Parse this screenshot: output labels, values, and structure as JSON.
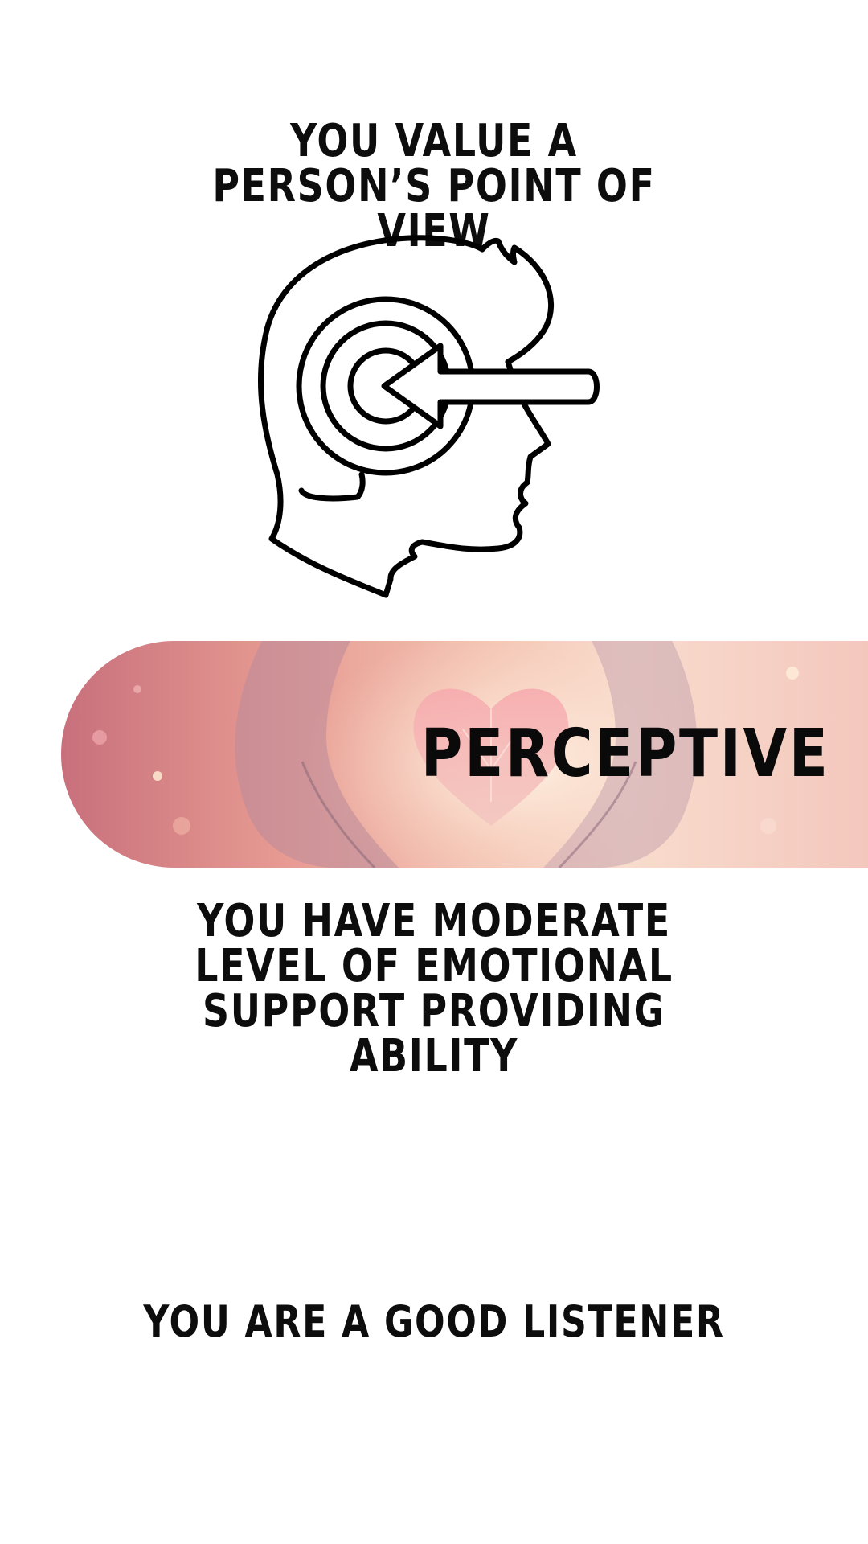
{
  "statements": {
    "point_of_view": "YOU VALUE A PERSON’S POINT OF VIEW",
    "emotional_support": "YOU HAVE MODERATE LEVEL OF EMOTIONAL SUPPORT PROVIDING ABILITY",
    "listener": "YOU ARE A GOOD LISTENER"
  },
  "banner": {
    "label": "PERCEPTIVE"
  },
  "icons": {
    "head": "head-target-arrow-icon",
    "banner_image": "hands-holding-heart-image"
  },
  "colors": {
    "text": "#0d0d0d",
    "banner_left": "#c8707c",
    "banner_right": "#f8dccd"
  }
}
